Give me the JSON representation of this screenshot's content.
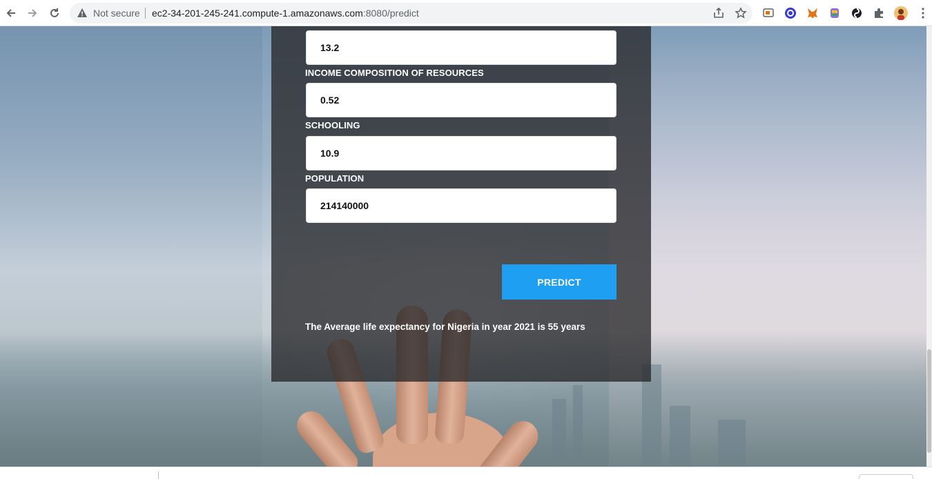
{
  "browser": {
    "security_text": "Not secure",
    "url_host": "ec2-34-201-245-241.compute-1.amazonaws.com",
    "url_rest": ":8080/predict"
  },
  "form": {
    "top_field_value": "13.2",
    "fields": [
      {
        "label": "INCOME COMPOSITION OF RESOURCES",
        "value": "0.52"
      },
      {
        "label": "SCHOOLING",
        "value": "10.9"
      },
      {
        "label": "POPULATION",
        "value": "214140000"
      }
    ],
    "predict_label": "PREDICT",
    "result_text": "The Average life expectancy for Nigeria in year 2021 is 55 years"
  },
  "colors": {
    "accent": "#1e9ff2",
    "panel": "#28282a"
  }
}
